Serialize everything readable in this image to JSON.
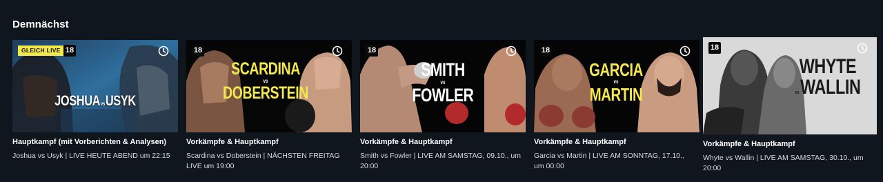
{
  "section": {
    "title": "Demnächst"
  },
  "cards": [
    {
      "badge": "GLEICH LIVE",
      "age": "18",
      "fighter_a": "JOSHUA",
      "vs": "vs",
      "fighter_b": "USYK",
      "title": "Hauptkampf (mit Vorberichten & Analysen)",
      "subtitle": "Joshua vs Usyk | LIVE HEUTE ABEND um 22:15"
    },
    {
      "age": "18",
      "fighter_a": "SCARDINA",
      "vs": "vs",
      "fighter_b": "DOBERSTEIN",
      "title": "Vorkämpfe & Hauptkampf",
      "subtitle": "Scardina vs Doberstein | NÄCHSTEN FREITAG LIVE um 19:00"
    },
    {
      "age": "18",
      "fighter_a": "SMITH",
      "vs": "vs",
      "fighter_b": "FOWLER",
      "title": "Vorkämpfe & Hauptkampf",
      "subtitle": "Smith vs Fowler | LIVE AM SAMSTAG, 09.10., um 20:00"
    },
    {
      "age": "18",
      "fighter_a": "GARCIA",
      "vs": "vs",
      "fighter_b": "MARTIN",
      "title": "Vorkämpfe & Hauptkampf",
      "subtitle": "Garcia vs Martin | LIVE AM SONNTAG, 17.10., um 00:00"
    },
    {
      "age": "18",
      "fighter_a": "WHYTE",
      "vs": "vs",
      "fighter_b": "WALLIN",
      "title": "Vorkämpfe & Hauptkampf",
      "subtitle": "Whyte vs Wallin | LIVE AM SAMSTAG, 30.10., um 20:00"
    }
  ],
  "colors": {
    "background": "#0f161e",
    "accent_yellow": "#f4e94c",
    "whyte_bg": "#d9d9d9"
  },
  "icons": {
    "clock": "clock-icon"
  }
}
